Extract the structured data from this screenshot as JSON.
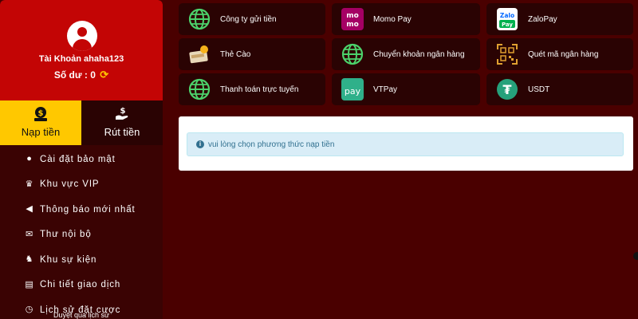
{
  "profile": {
    "account_name": "Tài Khoản ahaha123",
    "balance_label": "Số dư :",
    "balance_value": "0",
    "refresh_icon": "refresh-icon"
  },
  "tabs": [
    {
      "label": "Nạp tiền",
      "icon": "money-bag-icon",
      "active": true
    },
    {
      "label": "Rút tiền",
      "icon": "hand-money-icon",
      "active": false
    }
  ],
  "menu": [
    {
      "label": "Cài đặt bảo mật",
      "icon": "user-lock-icon"
    },
    {
      "label": "Khu vực VIP",
      "icon": "crown-icon"
    },
    {
      "label": "Thông báo mới nhất",
      "icon": "megaphone-icon"
    },
    {
      "label": "Thư nội bộ",
      "icon": "envelope-icon"
    },
    {
      "label": "Khu sự kiện",
      "icon": "trophy-icon"
    },
    {
      "label": "Chi tiết giao dịch",
      "icon": "document-icon"
    },
    {
      "label": "Lịch sử đặt cược",
      "icon": "history-icon"
    }
  ],
  "bottom_tip": "Duyệt qua lịch sử",
  "payment_methods": [
    {
      "label": "Công ty gửi tiền",
      "icon": "globe-icon"
    },
    {
      "label": "Momo Pay",
      "icon": "momo-icon",
      "icon_text_top": "mo",
      "icon_text_bottom": "mo"
    },
    {
      "label": "ZaloPay",
      "icon": "zalopay-icon",
      "icon_text_top": "Zalo",
      "icon_text_bottom": "Pay"
    },
    {
      "label": "Thẻ Cào",
      "icon": "scratch-card-icon"
    },
    {
      "label": "Chuyển khoản ngân hàng",
      "icon": "globe-icon"
    },
    {
      "label": "Quét mã ngân hàng",
      "icon": "qr-scan-icon"
    },
    {
      "label": "Thanh toán trực tuyến",
      "icon": "globe-icon"
    },
    {
      "label": "VTPay",
      "icon": "vtpay-icon",
      "icon_text": "pay"
    },
    {
      "label": "USDT",
      "icon": "tether-icon",
      "icon_text": "₮"
    }
  ],
  "notice": {
    "icon": "info-icon",
    "icon_text": "i",
    "text": "vui lòng chọn phương thức nạp tiền"
  },
  "colors": {
    "background": "#4a0000",
    "profile_bg": "#c30505",
    "active_tab": "#ffc800",
    "card_bg": "#2a0303",
    "info_bg": "#d9edf7",
    "info_text": "#31708f"
  }
}
